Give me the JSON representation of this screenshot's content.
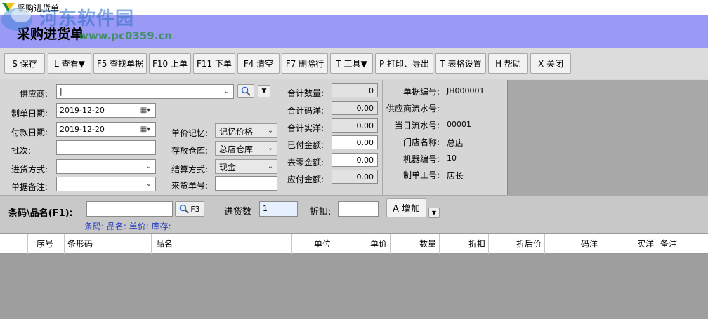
{
  "window": {
    "title": "采购进货单"
  },
  "watermark": {
    "text": "河东软件园",
    "url": "www.pc0359.cn"
  },
  "header": {
    "title": "采购进货单"
  },
  "toolbar": {
    "save": "S 保存",
    "view": "L 查看▼",
    "find": "F5 查找单据",
    "prev": "F10 上单",
    "next": "F11 下单",
    "clear": "F4 清空",
    "delete_row": "F7 删除行",
    "tools": "T 工具▼",
    "print": "P 打印、导出",
    "table_settings": "T 表格设置",
    "help": "H 帮助",
    "close": "X 关闭"
  },
  "form": {
    "supplier": {
      "label": "供应商:",
      "value": "|"
    },
    "create_date": {
      "label": "制单日期:",
      "value": "2019-12-20"
    },
    "pay_date": {
      "label": "付款日期:",
      "value": "2019-12-20"
    },
    "batch": {
      "label": "批次:",
      "value": ""
    },
    "purchase_method": {
      "label": "进货方式:",
      "value": ""
    },
    "remark": {
      "label": "单据备注:",
      "value": ""
    },
    "price_memory": {
      "label": "单价记忆:",
      "value": "记忆价格"
    },
    "warehouse": {
      "label": "存放仓库:",
      "value": "总店仓库"
    },
    "settle": {
      "label": "结算方式:",
      "value": "现金"
    },
    "incoming_no": {
      "label": "来货单号:",
      "value": ""
    }
  },
  "totals": {
    "qty": {
      "label": "合计数量:",
      "value": "0"
    },
    "code_amount": {
      "label": "合计码洋:",
      "value": "0.00"
    },
    "real_amount": {
      "label": "合计实洋:",
      "value": "0.00"
    },
    "paid": {
      "label": "已付金额:",
      "value": "0.00"
    },
    "rounding": {
      "label": "去零金额:",
      "value": "0.00"
    },
    "payable": {
      "label": "应付金额:",
      "value": "0.00"
    }
  },
  "doc_info": {
    "doc_no": {
      "label": "单据编号:",
      "value": "JH000001"
    },
    "supplier_serial": {
      "label": "供应商流水号:",
      "value": ""
    },
    "day_serial": {
      "label": "当日流水号:",
      "value": "00001"
    },
    "store": {
      "label": "门店名称:",
      "value": "总店"
    },
    "machine": {
      "label": "机器编号:",
      "value": "10"
    },
    "operator": {
      "label": "制单工号:",
      "value": "店长"
    }
  },
  "barcode_bar": {
    "label": "条码\\品名(F1):",
    "f3": "F3",
    "qty_label": "进货数",
    "qty_value": "1",
    "discount_label": "折扣:",
    "discount_value": "",
    "add": "A 增加",
    "hint": "条码: 品名: 单价: 库存:"
  },
  "grid": {
    "columns": [
      "序号",
      "条形码",
      "品名",
      "单位",
      "单价",
      "数量",
      "折扣",
      "折后价",
      "码洋",
      "实洋",
      "备注"
    ]
  }
}
